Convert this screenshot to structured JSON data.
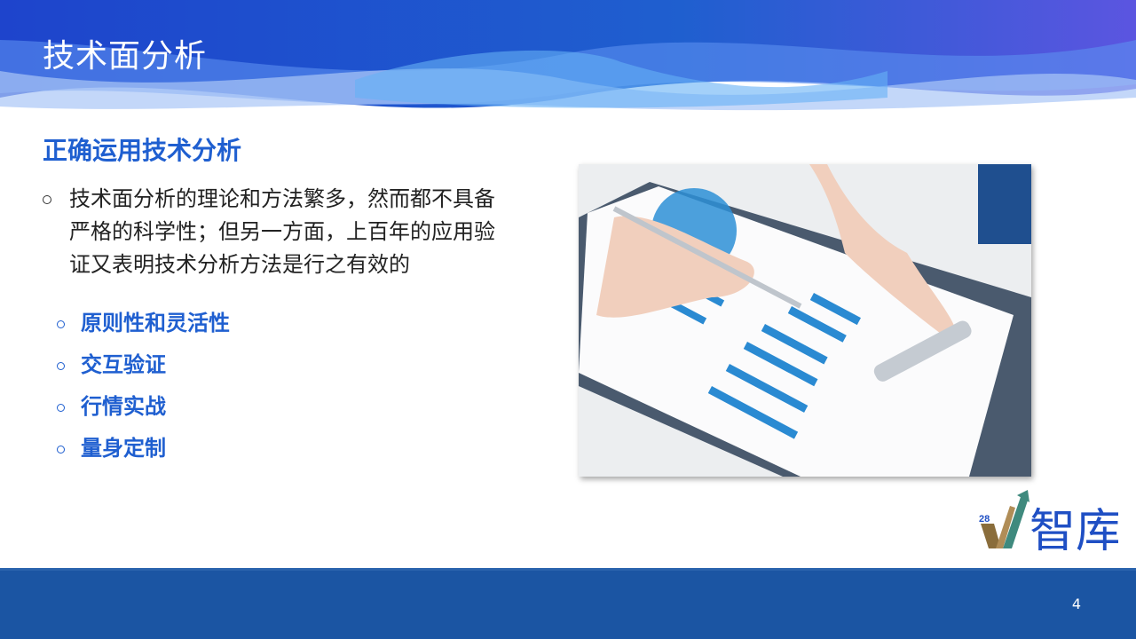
{
  "header": {
    "title": "技术面分析"
  },
  "content": {
    "subtitle": "正确运用技术分析",
    "paragraph": [
      "技术面分析的理论和方法繁多，然而都不具备",
      "严格的科学性；但另一方面，上百年的应用验",
      "证又表明技术分析方法是行之有效的"
    ],
    "items": [
      "原则性和灵活性",
      "交互验证",
      "行情实战",
      "量身定制"
    ]
  },
  "logo": {
    "number": "28",
    "text": "智库"
  },
  "footer": {
    "page_number": "4"
  },
  "colors": {
    "accent": "#1f5fd0",
    "footer": "#1b55a3"
  }
}
